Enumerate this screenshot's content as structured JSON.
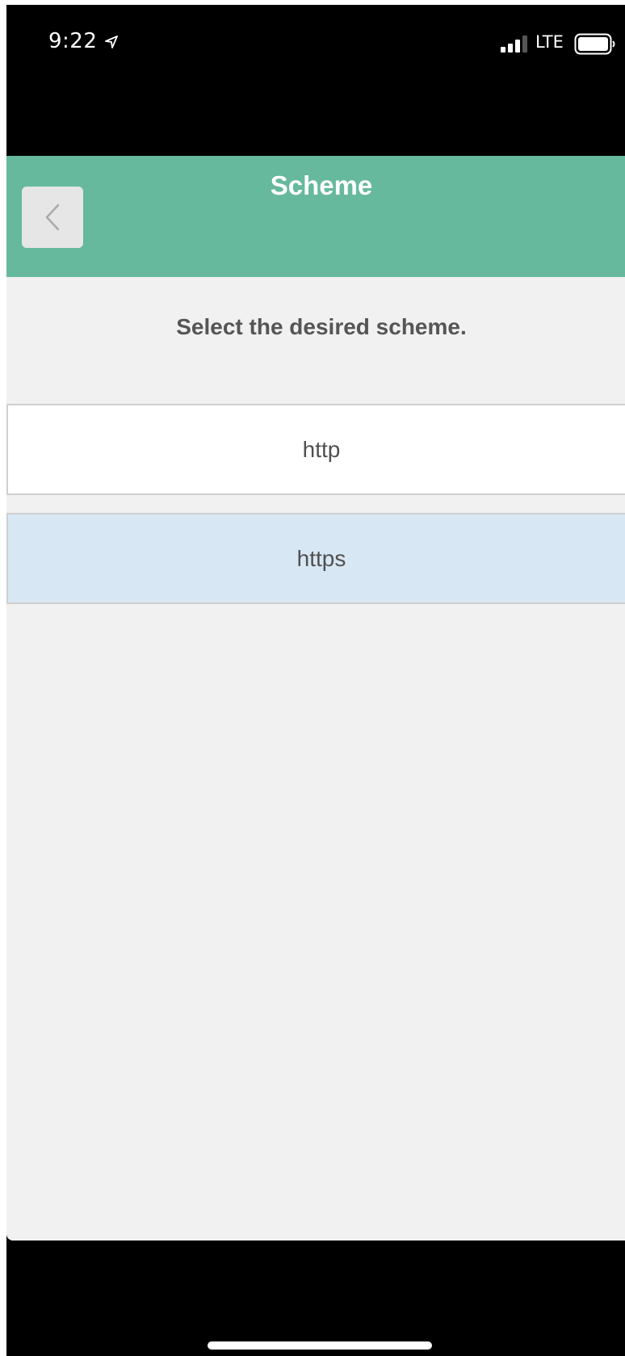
{
  "status_bar": {
    "time": "9:22",
    "network": "LTE",
    "icons": [
      "location-arrow-icon",
      "signal-icon",
      "battery-icon"
    ]
  },
  "header": {
    "title": "Scheme",
    "back_icon": "chevron-left-icon",
    "background_color": "#66b99c"
  },
  "main": {
    "instruction": "Select the desired scheme.",
    "options": [
      {
        "label": "http",
        "selected": false
      },
      {
        "label": "https",
        "selected": true
      }
    ],
    "selected_color": "#d8e7f4"
  }
}
